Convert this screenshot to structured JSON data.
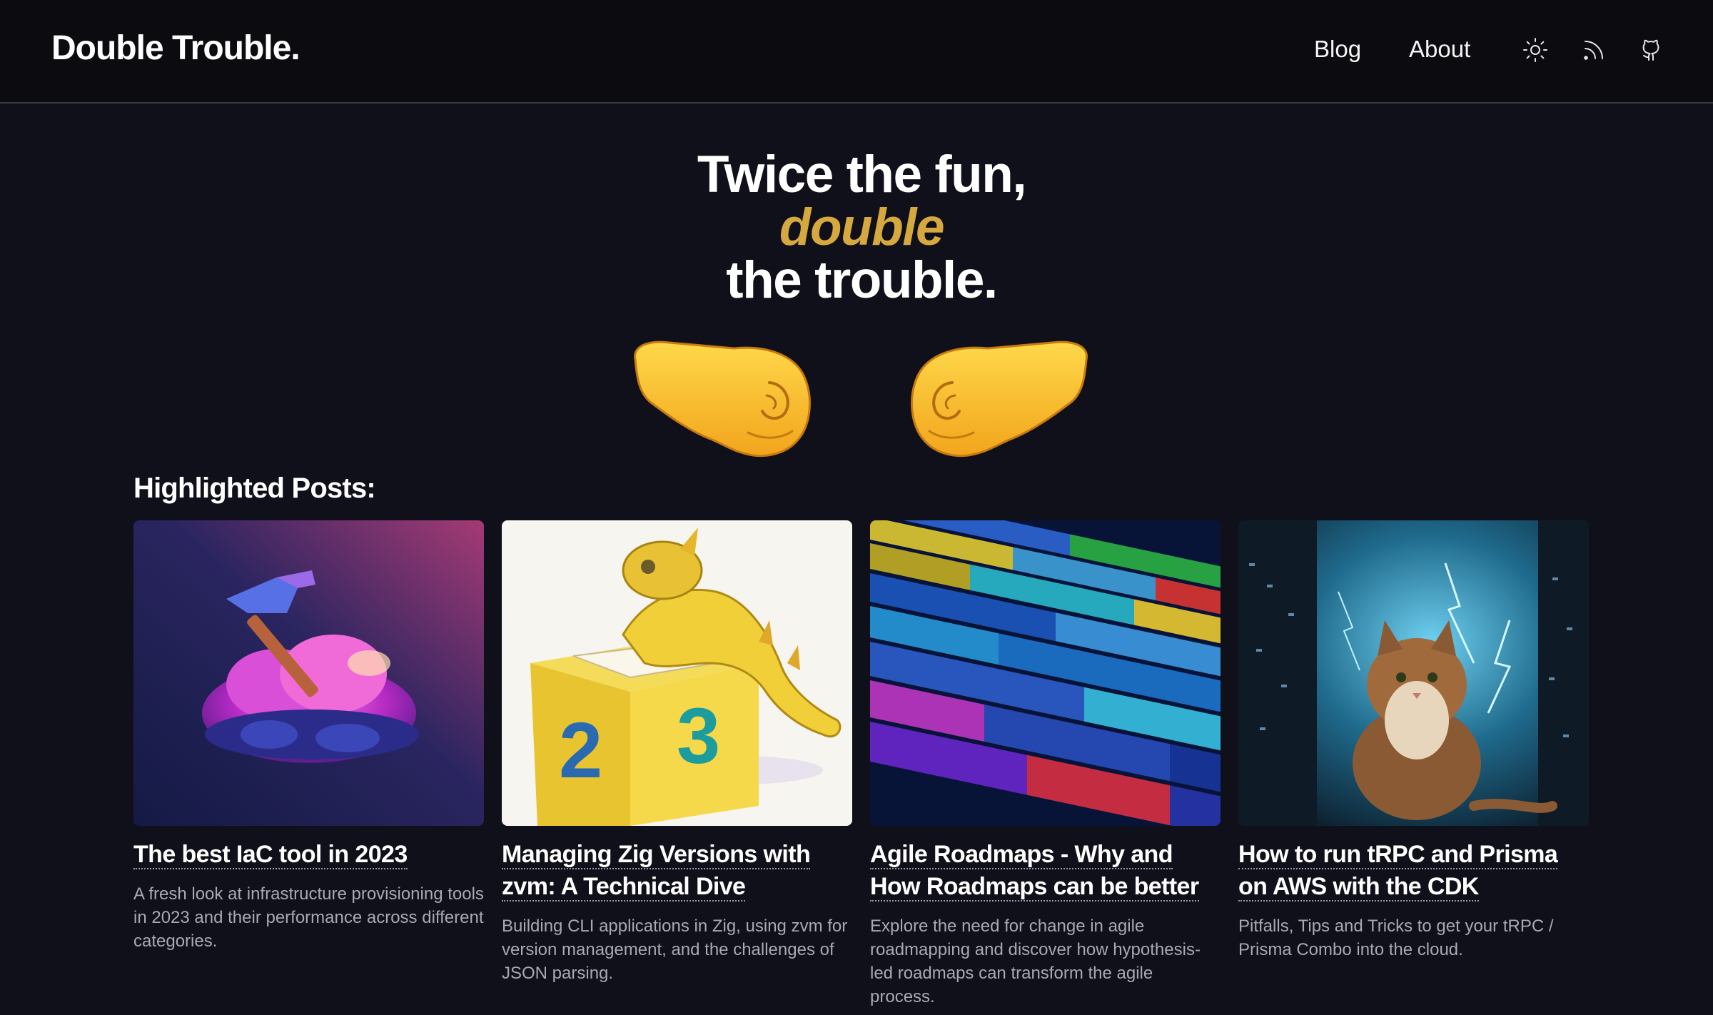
{
  "header": {
    "brand": "Double Trouble.",
    "nav": [
      {
        "label": "Blog"
      },
      {
        "label": "About"
      }
    ],
    "icons": [
      "sun-icon",
      "rss-icon",
      "github-icon"
    ]
  },
  "hero": {
    "line1": "Twice the fun,",
    "accent": "double",
    "line3": "the trouble.",
    "accent_color": "#d6a840",
    "emoji": [
      "left-facing-fist",
      "right-facing-fist"
    ]
  },
  "highlighted": {
    "title": "Highlighted Posts:",
    "posts": [
      {
        "title": "The best IaC tool in 2023",
        "description": "A fresh look at infrastructure provisioning tools in 2023 and their performance across different categories.",
        "image": "hammer-on-cloud-illustration"
      },
      {
        "title": "Managing Zig Versions with zvm: A Technical Dive",
        "description": "Building CLI applications in Zig, using zvm for version management, and the challenges of JSON parsing.",
        "image": "lizard-on-box-illustration"
      },
      {
        "title": "Agile Roadmaps - Why and How Roadmaps can be better",
        "description": "Explore the need for change in agile roadmapping and discover how hypothesis-led roadmaps can transform the agile process.",
        "image": "colorful-blocks-illustration"
      },
      {
        "title": "How to run tRPC and Prisma on AWS with the CDK",
        "description": "Pitfalls, Tips and Tricks to get your tRPC / Prisma Combo into the cloud.",
        "image": "cat-lightning-illustration"
      }
    ]
  },
  "colors": {
    "background": "#10101a",
    "header_bg": "#0c0c10",
    "text": "#ffffff",
    "muted": "#a9a9b2"
  }
}
